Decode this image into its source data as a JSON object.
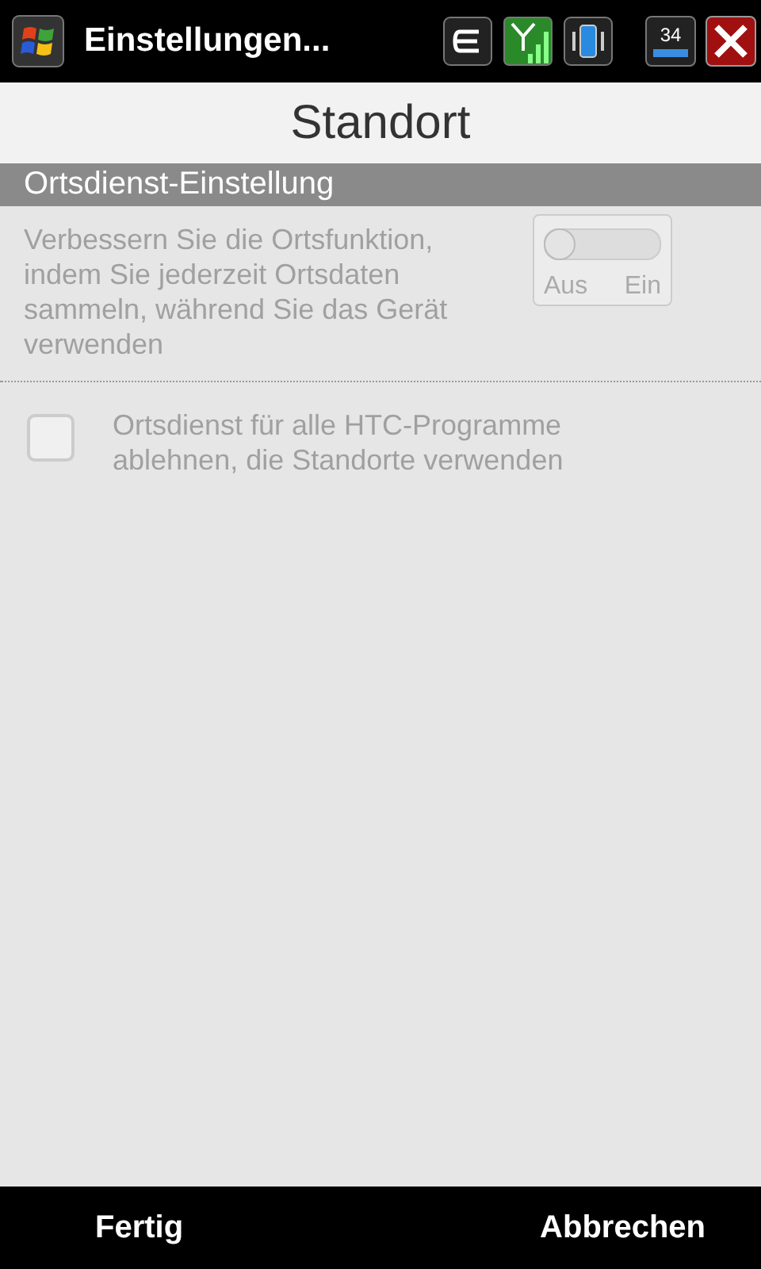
{
  "title_bar": {
    "title": "Einstellungen...",
    "battery": "34"
  },
  "page_title": "Standort",
  "section": {
    "title": "Ortsdienst-Einstellung"
  },
  "toggle_row": {
    "text": "Verbessern Sie die Ortsfunktion, indem Sie jederzeit Ortsdaten sammeln, während Sie das Gerät verwenden",
    "off_label": "Aus",
    "on_label": "Ein",
    "on": false,
    "disabled": true
  },
  "checkbox_row": {
    "text": "Ortsdienst für alle HTC-Programme ablehnen, die Standorte verwenden",
    "checked": false,
    "disabled": true
  },
  "softkeys": {
    "left": "Fertig",
    "right": "Abbrechen"
  }
}
